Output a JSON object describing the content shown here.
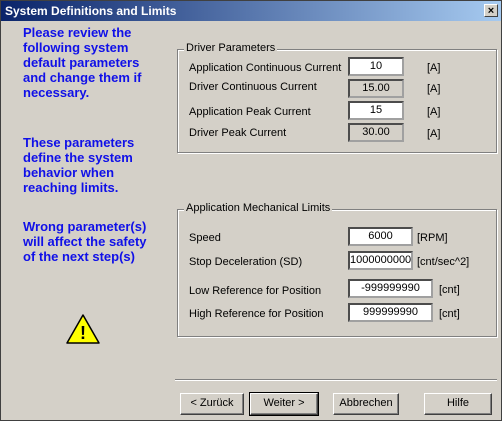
{
  "window": {
    "title": "System Definitions and Limits",
    "close_label": "×"
  },
  "info": {
    "para1": "Please review the following system default parameters and change them if necessary.",
    "para2": "These parameters define the system behavior when reaching limits.",
    "para3": "Wrong parameter(s) will affect the safety of the next step(s)",
    "warning_icon": "warning-triangle-icon",
    "warning_glyph": "!",
    "text_color": "#1010e8"
  },
  "driver_params": {
    "legend": "Driver Parameters",
    "rows": [
      {
        "label": "Application  Continuous Current",
        "value": "10",
        "unit": "[A]"
      },
      {
        "label": "Driver Continuous Current",
        "value": "15.00",
        "unit": "[A]"
      },
      {
        "label": "Application  Peak Current",
        "value": "15",
        "unit": "[A]"
      },
      {
        "label": "Driver Peak Current",
        "value": "30.00",
        "unit": "[A]"
      }
    ]
  },
  "mech_limits": {
    "legend": "Application Mechanical Limits",
    "rows": [
      {
        "label": "Speed",
        "value": "6000",
        "unit": "[RPM]"
      },
      {
        "label": "Stop Deceleration (SD)",
        "value": "1000000000",
        "unit": "[cnt/sec^2]"
      },
      {
        "label": "Low Reference for Position",
        "value": "-999999990",
        "unit": "[cnt]"
      },
      {
        "label": "High Reference for Position",
        "value": "999999990",
        "unit": "[cnt]"
      }
    ]
  },
  "buttons": {
    "back": "< Zurück",
    "next": "Weiter >",
    "cancel": "Abbrechen",
    "help": "Hilfe"
  }
}
